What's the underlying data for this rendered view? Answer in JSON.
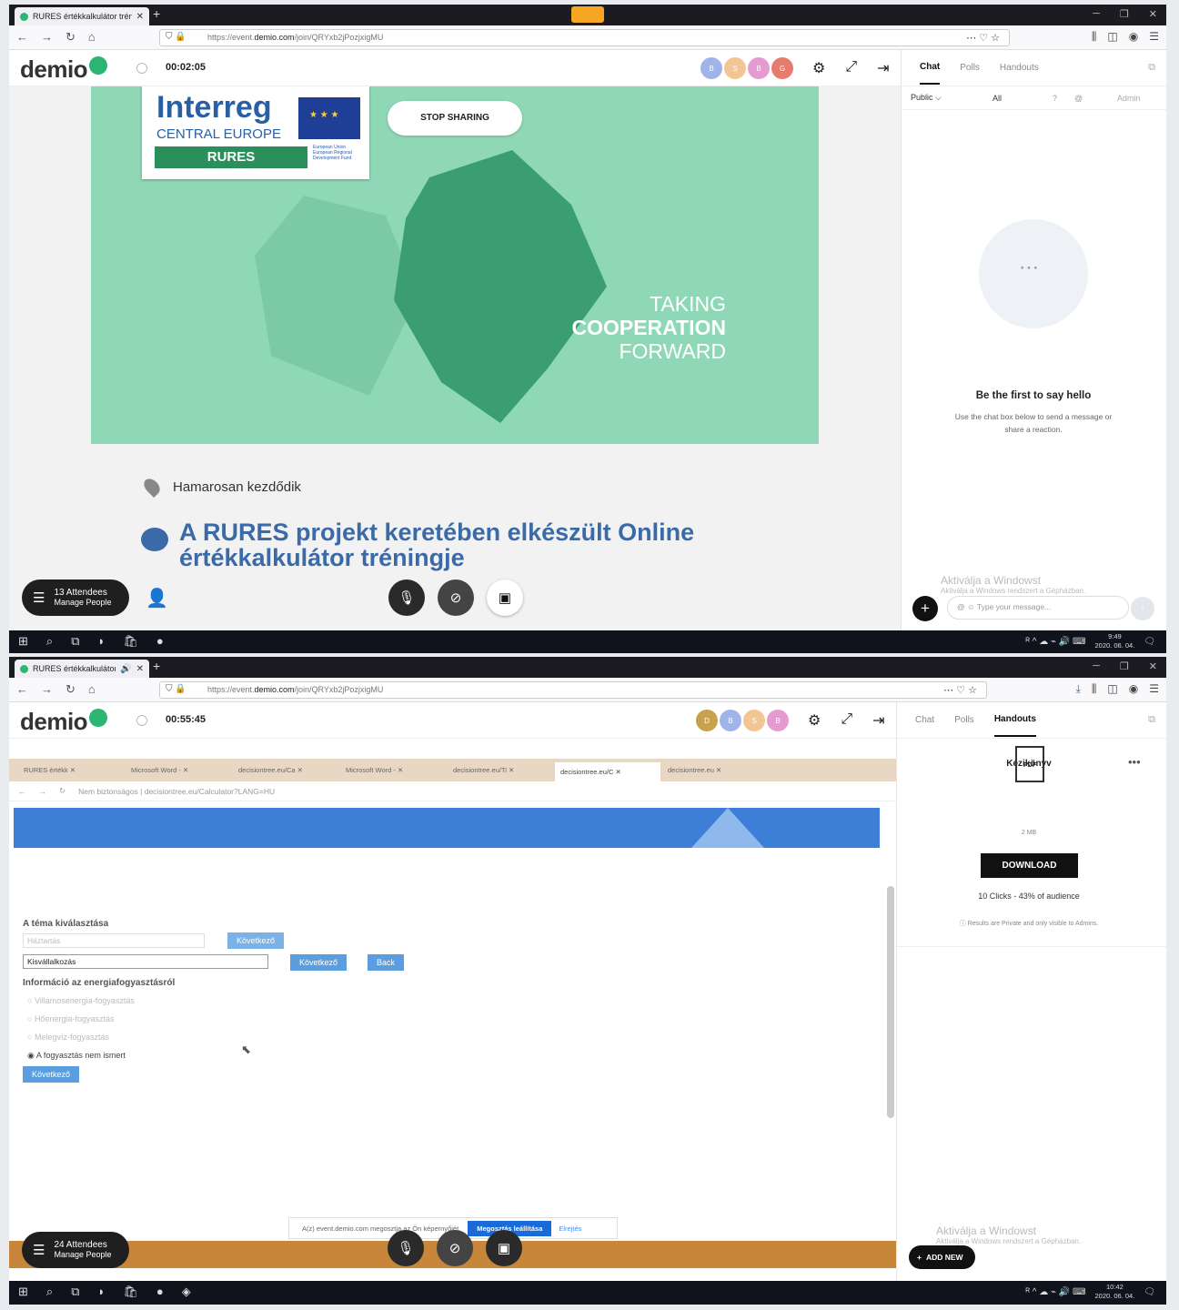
{
  "frame1": {
    "tab_title": "RURES értékkalkulátor tréning",
    "url_prefix": "https://event.",
    "url_domain": "demio.com",
    "url_path": "/join/QRYxb2jPozjxigMU",
    "logo": "demio",
    "timer": "00:02:05",
    "avatars": [
      {
        "initial": "B",
        "color": "#9fb5ea"
      },
      {
        "initial": "S",
        "color": "#f3c595"
      },
      {
        "initial": "B",
        "color": "#e59ad0"
      },
      {
        "initial": "G",
        "color": "#e57c6e"
      }
    ],
    "slide": {
      "brand": "Interreg",
      "region": "CENTRAL EUROPE",
      "project": "RURES",
      "eu_text": "European Union European Regional Development Fund",
      "stop_sharing": "STOP SHARING",
      "tag1": "TAKING",
      "tag2": "COOPERATION",
      "tag3": "FORWARD"
    },
    "location": "Hamarosan kezdődik",
    "event_title": "A RURES projekt keretében elkészült Online értékkalkulátor tréningje",
    "attendees_count": "13 Attendees",
    "attendees_action": "Manage People",
    "sidebar": {
      "tabs": [
        "Chat",
        "Polls",
        "Handouts"
      ],
      "active_tab": "Chat",
      "public_label": "Public ⌵",
      "all_label": "All",
      "admin_label": "Admin",
      "empty_title": "Be the first to say hello",
      "empty_sub": "Use the chat box below to send a message or share a reaction.",
      "message_placeholder": "Type your message...",
      "watermark": "Aktiválja a Windowst",
      "watermark_sub": "Aktiválja a Windows rendszert a Gépházban."
    },
    "clock_time": "9:49",
    "clock_date": "2020. 06. 04."
  },
  "frame2": {
    "tab_title": "RURES értékkalkulátor tréni",
    "url_prefix": "https://event.",
    "url_domain": "demio.com",
    "url_path": "/join/QRYxb2jPozjxigMU",
    "logo": "demio",
    "timer": "00:55:45",
    "avatars": [
      {
        "initial": "D",
        "color": "#c7a24b"
      },
      {
        "initial": "B",
        "color": "#9fb5ea"
      },
      {
        "initial": "S",
        "color": "#f3c595"
      },
      {
        "initial": "B",
        "color": "#e59ad0"
      }
    ],
    "shared": {
      "address": "Nem biztonságos | decisiontree.eu/Calculator?LANG=HU",
      "tabs": [
        "RURES értékk",
        "Microsoft Word -",
        "decisiontree.eu/Ca",
        "Microsoft Word -",
        "decisiontree.eu/Ti",
        "decisiontree.eu/C",
        "decisiontree.eu"
      ],
      "section_label": "A téma kiválasztása",
      "select1": "Háztartás",
      "select2": "Kisvállalkozás",
      "next": "Következő",
      "back": "Back",
      "energy_label": "Információ az energiafogyasztásról",
      "radios": [
        "Villamosenergia-fogyasztás",
        "Hőenergia-fogyasztás",
        "Melegvíz-fogyasztás",
        "A fogyasztás nem ismert"
      ],
      "next_bottom": "Következő",
      "share_note": "A(z) event.demio.com megosztja az Ön képernyőjét.",
      "stop_share_btn": "Megosztás leállítása",
      "hide": "Elrejtés"
    },
    "attendees_count": "24 Attendees",
    "attendees_action": "Manage People",
    "sidebar": {
      "tabs": [
        "Chat",
        "Polls",
        "Handouts"
      ],
      "active_tab": "Handouts",
      "handout_title": "Kézikönyv",
      "pdf": "PDF",
      "size": "2 MB",
      "download": "DOWNLOAD",
      "stats": "10 Clicks - 43% of audience",
      "privacy_note": "Results are Private and only visible to Admins.",
      "add_new": "ADD NEW",
      "watermark": "Aktiválja a Windowst",
      "watermark_sub": "Aktiválja a Windows rendszert a Gépházban."
    },
    "clock_time": "10:42",
    "clock_date": "2020. 06. 04."
  }
}
